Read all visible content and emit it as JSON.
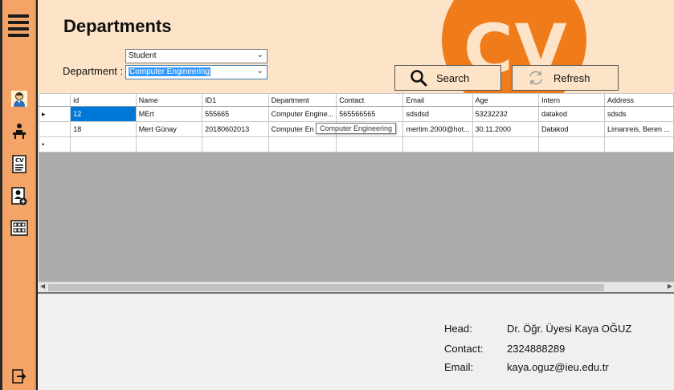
{
  "header": {
    "title": "Departments",
    "department_label": "Department :",
    "logo_text": "CV"
  },
  "filters": {
    "type_combo_value": "Student",
    "department_combo_value": "Computer Engineering"
  },
  "buttons": {
    "search": "Search",
    "refresh": "Refresh"
  },
  "sidebar": {
    "icons": [
      "menu-icon",
      "student-icon",
      "teacher-icon",
      "cv-document-icon",
      "add-user-icon",
      "department-building-icon",
      "logout-icon"
    ]
  },
  "grid": {
    "columns": [
      "id",
      "Name",
      "ID1",
      "Department",
      "Contact",
      "Email",
      "Age",
      "Intern",
      "Address"
    ],
    "rows": [
      [
        "12",
        "MErt",
        "555665",
        "Computer Engine...",
        "565566565",
        "sdsdsd",
        "53232232",
        "datakod",
        "sdsds"
      ],
      [
        "18",
        "Mert Günay",
        "20180602013",
        "Computer En",
        "",
        "mertim.2000@hot...",
        "30.11.2000",
        "Datakod",
        "Limanreis, Beren ..."
      ]
    ],
    "tooltip": "Computer Engineering"
  },
  "info": {
    "head_label": "Head:",
    "head_value": "Dr. Öğr. Üyesi Kaya OĞUZ",
    "contact_label": "Contact:",
    "contact_value": "2324888289",
    "email_label": "Email:",
    "email_value": "kaya.oguz@ieu.edu.tr"
  },
  "colors": {
    "sidebar": "#f4a466",
    "header_bg": "#fde3c7",
    "logo_orange": "#f07b1a",
    "selection": "#0078d7"
  }
}
